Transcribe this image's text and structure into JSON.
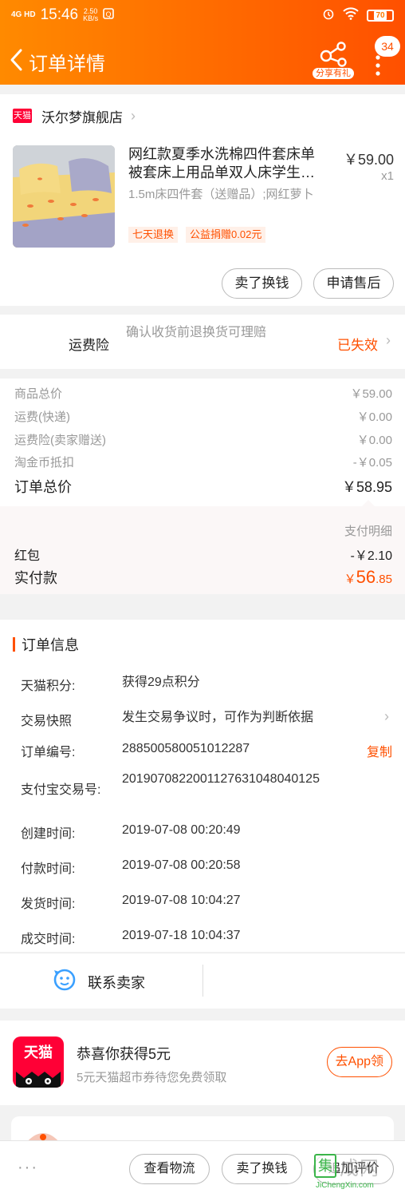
{
  "status_bar": {
    "signal": "4G HD",
    "time": "15:46",
    "net_speed_value": "2.50",
    "net_speed_unit": "KB/s",
    "battery": "70"
  },
  "header": {
    "title": "订单详情",
    "share_label": "分享有礼",
    "badge_count": "34",
    "color": "#ff6a00"
  },
  "store": {
    "logo_text": "天猫",
    "name": "沃尔梦旗舰店"
  },
  "product": {
    "title": "网红款夏季水洗棉四件套床单被套床上用品单双人床学生…",
    "price": "￥59.00",
    "qty": "x1",
    "sku": "1.5m床四件套（送赠品）;网红萝卜",
    "tags": [
      "七天退换",
      "公益捐赠0.02元"
    ]
  },
  "product_actions": {
    "sell_label": "卖了换钱",
    "after_sale_label": "申请售后"
  },
  "insurance": {
    "label": "运费险",
    "desc": "确认收货前退换货可理赔",
    "status": "已失效"
  },
  "fees": {
    "rows": [
      {
        "label": "商品总价",
        "value": "￥59.00"
      },
      {
        "label": "运费(快递)",
        "value": "￥0.00"
      },
      {
        "label": "运费险(卖家赠送)",
        "value": "￥0.00"
      },
      {
        "label": "淘金币抵扣",
        "value": "-￥0.05"
      }
    ],
    "total_label": "订单总价",
    "total_value": "￥58.95"
  },
  "payment": {
    "detail_link": "支付明细",
    "hongbao_label": "红包",
    "hongbao_value": "-￥2.10",
    "paid_label": "实付款",
    "paid_currency": "￥",
    "paid_int": "56",
    "paid_dec": ".85"
  },
  "order_info": {
    "title": "订单信息",
    "rows": [
      {
        "label": "天猫积分:",
        "value": "获得29点积分"
      },
      {
        "label": "交易快照",
        "value": "发生交易争议时，可作为判断依据"
      },
      {
        "label": "订单编号:",
        "value": "288500580051012287"
      },
      {
        "label": "支付宝交易号:",
        "value": "2019070822001127631048040125"
      },
      {
        "label": "创建时间:",
        "value": "2019-07-08 00:20:49"
      },
      {
        "label": "付款时间:",
        "value": "2019-07-08 00:20:58"
      },
      {
        "label": "发货时间:",
        "value": "2019-07-08 10:04:27"
      },
      {
        "label": "成交时间:",
        "value": "2019-07-18 10:04:37"
      }
    ],
    "copy_label": "复制"
  },
  "contact": {
    "label": "联系卖家"
  },
  "promo": {
    "logo_text": "天猫",
    "title": "恭喜你获得5元",
    "subtitle": "5元天猫超市券待您免费领取",
    "button": "去App领"
  },
  "bottom_bar": {
    "more": "···",
    "logistics_label": "查看物流",
    "sell_label": "卖了换钱",
    "review_label": "追加评价"
  },
  "watermark": {
    "box_char": "集",
    "text": "成网",
    "url": "JiChengXin.com"
  }
}
